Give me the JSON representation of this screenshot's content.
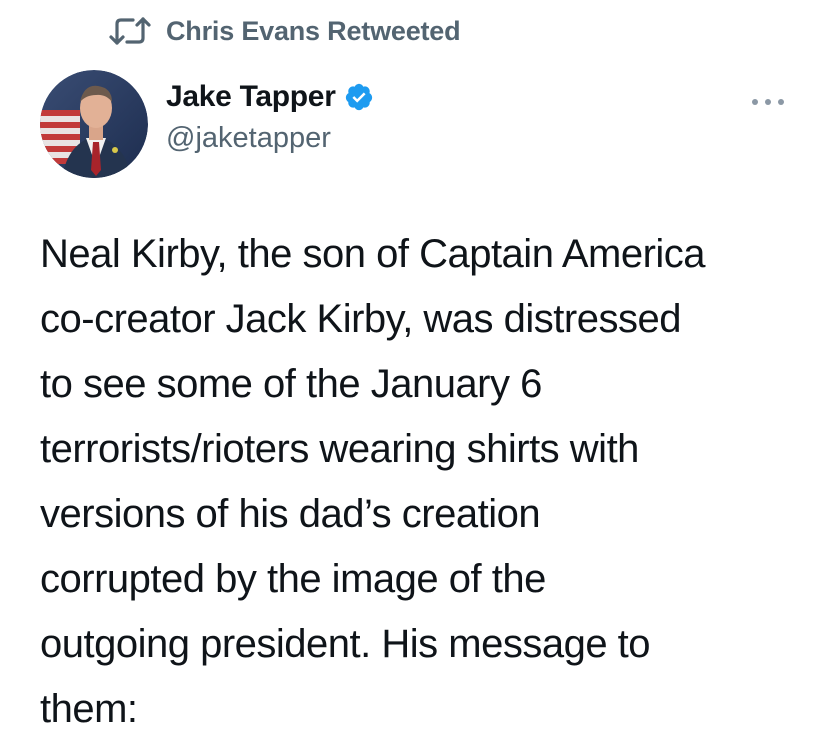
{
  "retweet": {
    "icon": "retweet-icon",
    "text": "Chris Evans Retweeted"
  },
  "author": {
    "name": "Jake Tapper",
    "handle": "@jaketapper",
    "verified": true,
    "verified_color": "#1d9bf0"
  },
  "more_icon": "more-options-icon",
  "tweet": {
    "lines": [
      "Neal Kirby, the son of Captain America",
      "co-creator Jack Kirby, was distressed",
      "to see some of the January 6",
      "terrorists/rioters wearing shirts with",
      "versions of his dad’s creation",
      "corrupted by the image of the",
      "outgoing president. His message to",
      "them:"
    ]
  },
  "colors": {
    "text_primary": "#0f1419",
    "text_secondary": "#536471",
    "background": "#ffffff"
  }
}
